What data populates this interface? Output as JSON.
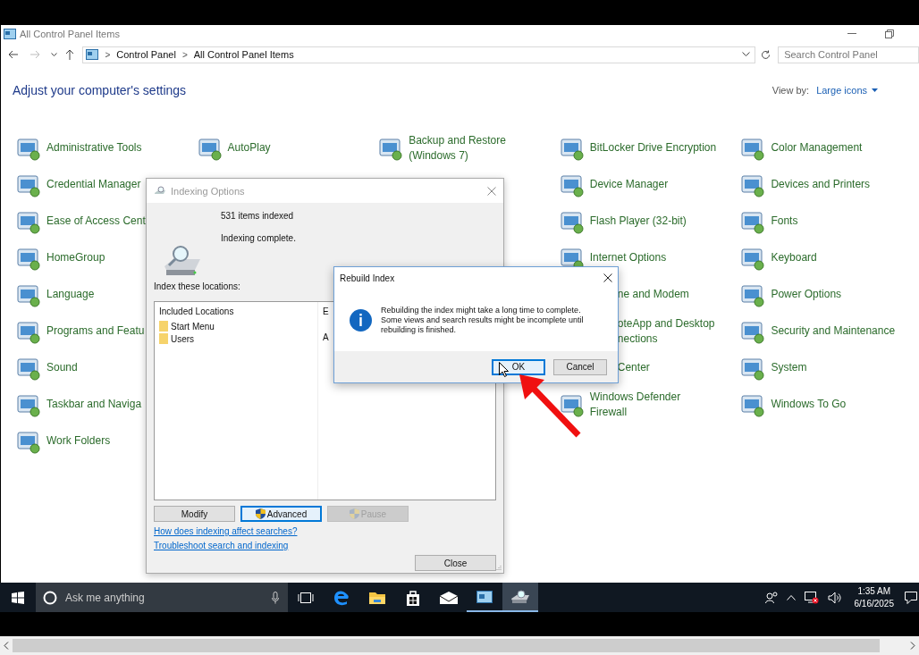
{
  "window": {
    "title": "All Control Panel Items"
  },
  "address_bar": {
    "path": [
      "Control Panel",
      "All Control Panel Items"
    ],
    "separator": ">"
  },
  "search": {
    "placeholder": "Search Control Panel"
  },
  "heading": "Adjust your computer's settings",
  "view_by": {
    "label": "View by:",
    "value": "Large icons"
  },
  "columns": [
    [
      {
        "label": "Administrative Tools",
        "kind": "full"
      },
      {
        "label": "Credential Manager",
        "kind": "full"
      },
      {
        "label": "Ease of Access Cent",
        "kind": "full"
      },
      {
        "label": "HomeGroup",
        "kind": "full"
      },
      {
        "label": "Language",
        "kind": "full"
      },
      {
        "label": "Programs and Featu",
        "kind": "full"
      },
      {
        "label": "Sound",
        "kind": "full"
      },
      {
        "label": "Taskbar and Naviga",
        "kind": "full"
      },
      {
        "label": "Work Folders",
        "kind": "full"
      }
    ],
    [
      {
        "label": "AutoPlay",
        "kind": "full"
      }
    ],
    [
      {
        "label": "Backup and Restore\n(Windows 7)",
        "kind": "full"
      }
    ],
    [
      {
        "label": "BitLocker Drive Encryption",
        "kind": "full"
      },
      {
        "label": "Device Manager",
        "kind": "full"
      },
      {
        "label": "Flash Player (32-bit)",
        "kind": "full"
      },
      {
        "label": "Internet Options",
        "kind": "full"
      },
      {
        "label": "ne and Modem",
        "kind": "cut"
      },
      {
        "label": "oteApp and Desktop\nnections",
        "kind": "cut"
      },
      {
        "label": "Center",
        "kind": "cut"
      },
      {
        "label": "Windows Defender\nFirewall",
        "kind": "full"
      }
    ],
    [
      {
        "label": "Color Management",
        "kind": "full"
      },
      {
        "label": "Devices and Printers",
        "kind": "full"
      },
      {
        "label": "Fonts",
        "kind": "full"
      },
      {
        "label": "Keyboard",
        "kind": "full"
      },
      {
        "label": "Power Options",
        "kind": "full"
      },
      {
        "label": "Security and Maintenance",
        "kind": "full"
      },
      {
        "label": "System",
        "kind": "full"
      },
      {
        "label": "Windows To Go",
        "kind": "full"
      }
    ]
  ],
  "indexing_dialog": {
    "title": "Indexing Options",
    "items_indexed": "531 items indexed",
    "status": "Indexing complete.",
    "locations_label": "Index these locations:",
    "table": {
      "columns": [
        "Included Locations",
        "E"
      ],
      "rows": [
        {
          "location": "Start Menu"
        },
        {
          "location": "Users",
          "column_2": "A"
        }
      ]
    },
    "buttons": [
      {
        "label": "Modify",
        "shield": false,
        "focused": false,
        "disabled": false
      },
      {
        "label": "Advanced",
        "shield": true,
        "focused": true,
        "disabled": false
      },
      {
        "label": "Pause",
        "shield": true,
        "focused": false,
        "disabled": true
      }
    ],
    "links": [
      "How does indexing affect searches?",
      "Troubleshoot search and indexing"
    ],
    "close_button": "Close"
  },
  "rebuild_dialog": {
    "title": "Rebuild Index",
    "message": "Rebuilding the index might take a long time to complete.\nSome views and search results might be incomplete until\nrebuilding is finished.",
    "buttons": [
      {
        "label": "OK",
        "focused": true
      },
      {
        "label": "Cancel",
        "focused": false
      }
    ]
  },
  "taskbar": {
    "search_placeholder": "Ask me anything",
    "apps": [
      {
        "kind": "task-view",
        "running": false,
        "selected": false
      },
      {
        "kind": "browser",
        "running": false,
        "selected": false
      },
      {
        "kind": "folder",
        "running": false,
        "selected": false
      },
      {
        "kind": "store",
        "running": false,
        "selected": false
      },
      {
        "kind": "mail",
        "running": false,
        "selected": false
      },
      {
        "kind": "control-panel",
        "running": true,
        "selected": false
      },
      {
        "kind": "indexing",
        "running": true,
        "selected": true
      }
    ],
    "time": "1:35 AM",
    "date": "6/16/2025"
  }
}
